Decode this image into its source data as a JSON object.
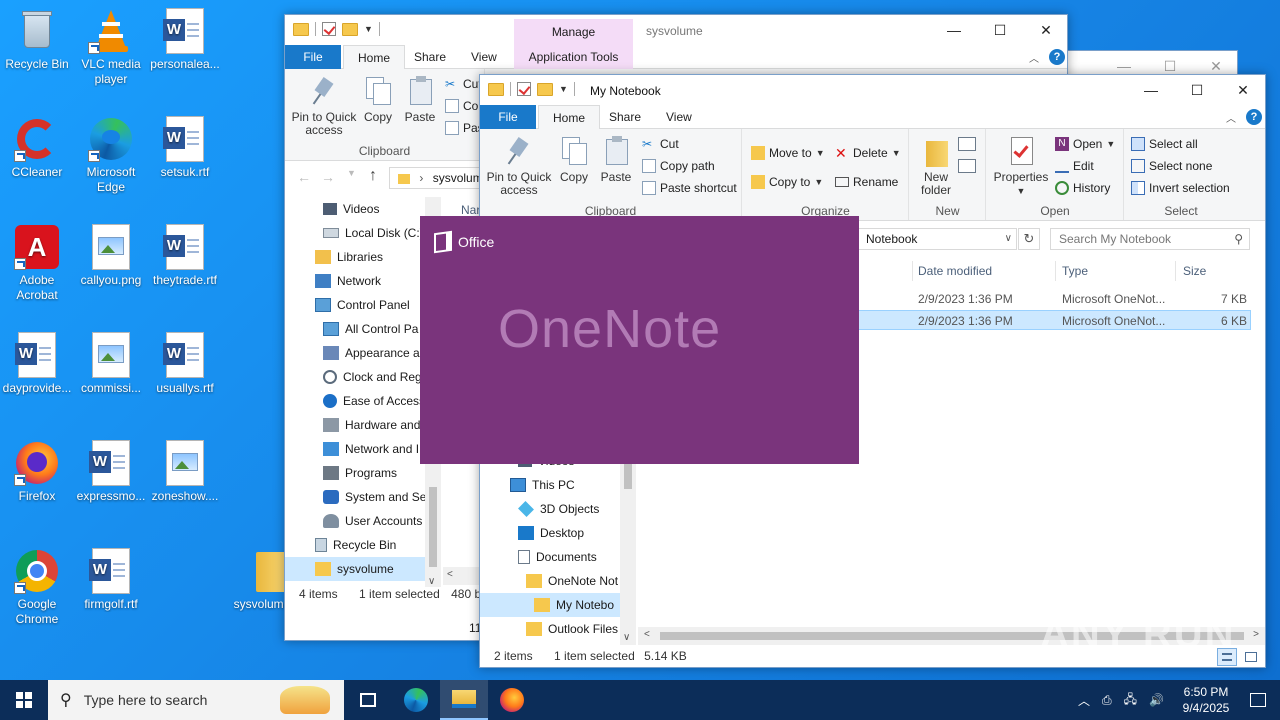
{
  "desktop": {
    "icons": [
      {
        "label": "Recycle Bin",
        "type": "recycle"
      },
      {
        "label": "VLC media player",
        "type": "vlc"
      },
      {
        "label": "personalea...",
        "type": "word"
      },
      {
        "label": "CCleaner",
        "type": "ccleaner"
      },
      {
        "label": "Microsoft Edge",
        "type": "edge"
      },
      {
        "label": "setsuk.rtf",
        "type": "word"
      },
      {
        "label": "Adobe Acrobat",
        "type": "acrobat"
      },
      {
        "label": "callyou.png",
        "type": "image"
      },
      {
        "label": "theytrade.rtf",
        "type": "word"
      },
      {
        "label": "dayprovide...",
        "type": "word"
      },
      {
        "label": "commissi...",
        "type": "image"
      },
      {
        "label": "usuallys.rtf",
        "type": "word"
      },
      {
        "label": "Firefox",
        "type": "firefox"
      },
      {
        "label": "expressmo...",
        "type": "word"
      },
      {
        "label": "zoneshow....",
        "type": "image"
      },
      {
        "label": "Google Chrome",
        "type": "chrome"
      },
      {
        "label": "firmgolf.rtf",
        "type": "word"
      },
      {
        "label": "sysvolume",
        "type": "folder"
      }
    ]
  },
  "win1": {
    "title": "sysvolume",
    "context_tab": "Manage",
    "context_subtab": "Application Tools",
    "tabs": [
      "File",
      "Home",
      "Share",
      "View"
    ],
    "clipboard": {
      "pin": "Pin to Quick access",
      "copy": "Copy",
      "paste": "Paste",
      "cut": "Cut",
      "copy_path": "Co",
      "paste_short": "Pas",
      "group": "Clipboard"
    },
    "address": "sysvolum",
    "col_name": "Nar",
    "nav": [
      "Videos",
      "Local Disk (C:)",
      "Libraries",
      "Network",
      "Control Panel",
      "All Control Pa",
      "Appearance ar",
      "Clock and Reg",
      "Ease of Access",
      "Hardware and",
      "Network and I",
      "Programs",
      "System and Se",
      "User Accounts",
      "Recycle Bin",
      "sysvolume"
    ],
    "status_items": "4 items",
    "status_selected": "1 item selected",
    "status_size": "480 byt",
    "partial_row": "11"
  },
  "win2": {
    "title": "My Notebook",
    "tabs": [
      "File",
      "Home",
      "Share",
      "View"
    ],
    "clipboard": {
      "pin": "Pin to Quick access",
      "copy": "Copy",
      "paste": "Paste",
      "cut": "Cut",
      "copy_path": "Copy path",
      "paste_shortcut": "Paste shortcut",
      "group": "Clipboard"
    },
    "organize": {
      "move_to": "Move to",
      "copy_to": "Copy to",
      "delete": "Delete",
      "rename": "Rename",
      "group": "Organize"
    },
    "new": {
      "new_folder": "New folder",
      "group": "New"
    },
    "open": {
      "properties": "Properties",
      "open": "Open",
      "edit": "Edit",
      "history": "History",
      "group": "Open"
    },
    "select": {
      "select_all": "Select all",
      "select_none": "Select none",
      "invert": "Invert selection",
      "group": "Select"
    },
    "address": "Notebook",
    "search_placeholder": "Search My Notebook",
    "columns": {
      "date": "Date modified",
      "type": "Type",
      "size": "Size"
    },
    "files": [
      {
        "date": "2/9/2023 1:36 PM",
        "type": "Microsoft OneNot...",
        "size": "7 KB",
        "selected": false
      },
      {
        "date": "2/9/2023 1:36 PM",
        "type": "Microsoft OneNot...",
        "size": "6 KB",
        "selected": true
      }
    ],
    "nav": [
      "Videos",
      "This PC",
      "3D Objects",
      "Desktop",
      "Documents",
      "OneNote Not",
      "My Notebo",
      "Outlook Files"
    ],
    "status_items": "2 items",
    "status_selected": "1 item selected",
    "status_size": "5.14 KB"
  },
  "splash": {
    "brand": "Office",
    "app": "OneNote"
  },
  "taskbar": {
    "search_placeholder": "Type here to search",
    "time": "6:50 PM",
    "date": "9/4/2025"
  },
  "watermark": "ANY RUN",
  "colors": {
    "accent": "#1979ca",
    "onenote": "#7a347c",
    "taskbar": "#0c2d59",
    "selection": "#cce8ff"
  }
}
